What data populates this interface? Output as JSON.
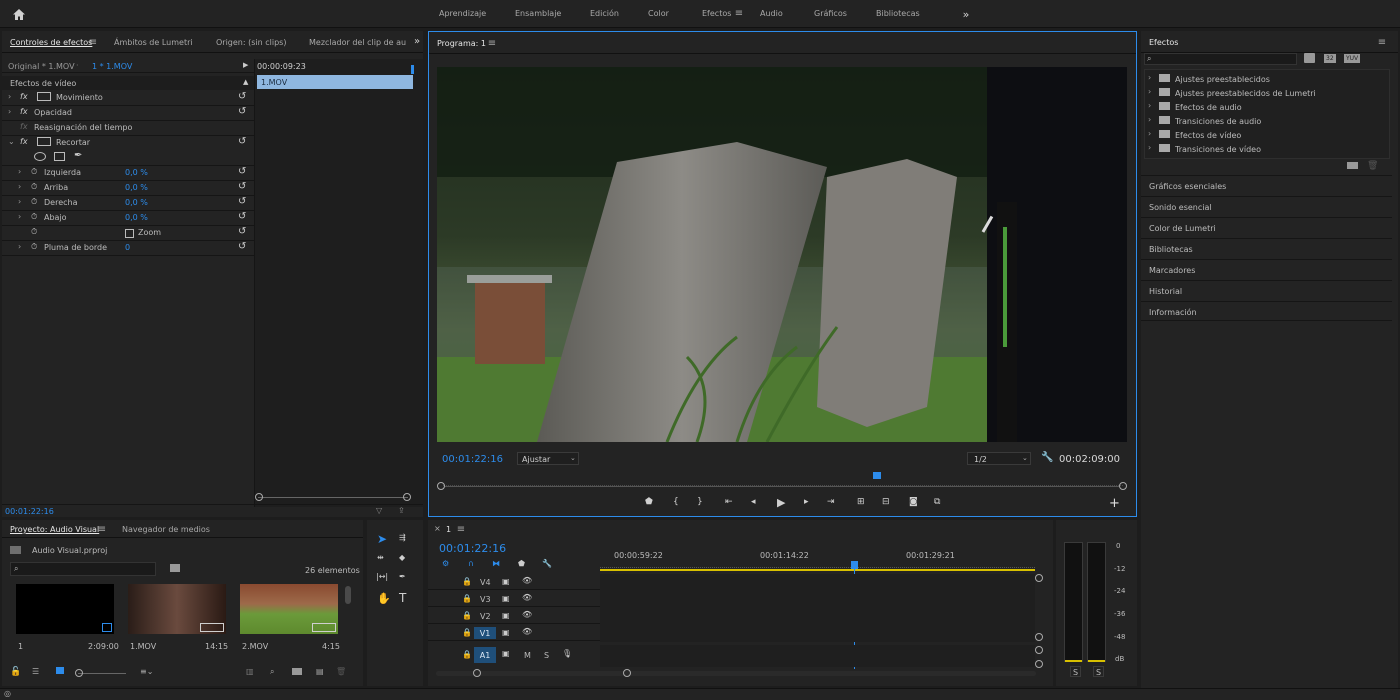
{
  "workspace_tabs": [
    "Aprendizaje",
    "Ensamblaje",
    "Edición",
    "Color",
    "Efectos",
    "Audio",
    "Gráficos",
    "Bibliotecas"
  ],
  "active_workspace": "Efectos",
  "effect_controls": {
    "tabs": [
      "Controles de efectos",
      "Ámbitos de Lumetri",
      "Origen: (sin clips)",
      "Mezclador del clip de au"
    ],
    "source_master": "Original * 1.MOV",
    "source_clip": "1 * 1.MOV",
    "timecode_top": "00:00:09:23",
    "clip_label": "1.MOV",
    "section": "Efectos de vídeo",
    "effects": [
      "Movimiento",
      "Opacidad",
      "Reasignación del tiempo",
      "Recortar"
    ],
    "params": [
      {
        "name": "Izquierda",
        "value": "0,0 %"
      },
      {
        "name": "Arriba",
        "value": "0,0 %"
      },
      {
        "name": "Derecha",
        "value": "0,0 %"
      },
      {
        "name": "Abajo",
        "value": "0,0 %"
      }
    ],
    "zoom_label": "Zoom",
    "feather_label": "Pluma de borde",
    "feather_value": "0",
    "current_time": "00:01:22:16"
  },
  "program": {
    "title": "Programa: 1",
    "timecode": "00:01:22:16",
    "fit": "Ajustar",
    "quality": "1/2",
    "duration": "00:02:09:00"
  },
  "effects_panel": {
    "title": "Efectos",
    "items": [
      "Ajustes preestablecidos",
      "Ajustes preestablecidos de Lumetri",
      "Efectos de audio",
      "Transiciones de audio",
      "Efectos de vídeo",
      "Transiciones de vídeo"
    ],
    "badges": [
      "32",
      "YUV"
    ],
    "sections": [
      "Gráficos esenciales",
      "Sonido esencial",
      "Color de Lumetri",
      "Bibliotecas",
      "Marcadores",
      "Historial",
      "Información"
    ]
  },
  "project": {
    "tabs": [
      "Proyecto: Audio Visual",
      "Navegador de medios"
    ],
    "file": "Audio Visual.prproj",
    "count": "26 elementos",
    "clips": [
      {
        "name": "1",
        "duration": "2:09:00"
      },
      {
        "name": "1.MOV",
        "duration": "14:15"
      },
      {
        "name": "2.MOV",
        "duration": "4:15"
      }
    ]
  },
  "timeline": {
    "title": "1",
    "timecode": "00:01:22:16",
    "ruler": [
      "00:00:59:22",
      "00:01:14:22",
      "00:01:29:21"
    ],
    "video_tracks": [
      "V4",
      "V3",
      "V2",
      "V1"
    ],
    "audio_tracks": [
      "A1"
    ],
    "mute": "M",
    "solo": "S"
  },
  "meter": {
    "ticks": [
      "0",
      "-12",
      "-24",
      "-36",
      "-48",
      "dB"
    ],
    "solo": [
      "S",
      "S"
    ]
  },
  "colors": {
    "accent": "#2d8ceb",
    "panel": "#232323",
    "bg": "#1d1d1d",
    "track": "#1f4f7a",
    "work_bar": "#d8c000"
  }
}
